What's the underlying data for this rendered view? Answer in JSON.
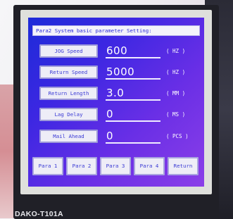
{
  "screen": {
    "title": "Para2  System basic parameter Setting:",
    "params": [
      {
        "label": "JOG Speed",
        "value": "600",
        "unit": "( HZ )"
      },
      {
        "label": "Return Speed",
        "value": "5000",
        "unit": "( HZ )"
      },
      {
        "label": "Return Length",
        "value": "3.0",
        "unit": "( MM )"
      },
      {
        "label": "Lag Delay",
        "value": "0",
        "unit": "( MS )"
      },
      {
        "label": "Mail Ahead",
        "value": "0",
        "unit": "( PCS )"
      }
    ],
    "buttons": [
      {
        "label": "Para 1"
      },
      {
        "label": "Para 2"
      },
      {
        "label": "Para 3"
      },
      {
        "label": "Para 4"
      },
      {
        "label": "Return"
      }
    ]
  },
  "device": {
    "model": "DAKO-T101A"
  },
  "colors": {
    "screen_background": "#3c27e2",
    "button_face": "#eeedf7",
    "label_text": "#3a3ad4",
    "value_text": "#ffffff"
  }
}
